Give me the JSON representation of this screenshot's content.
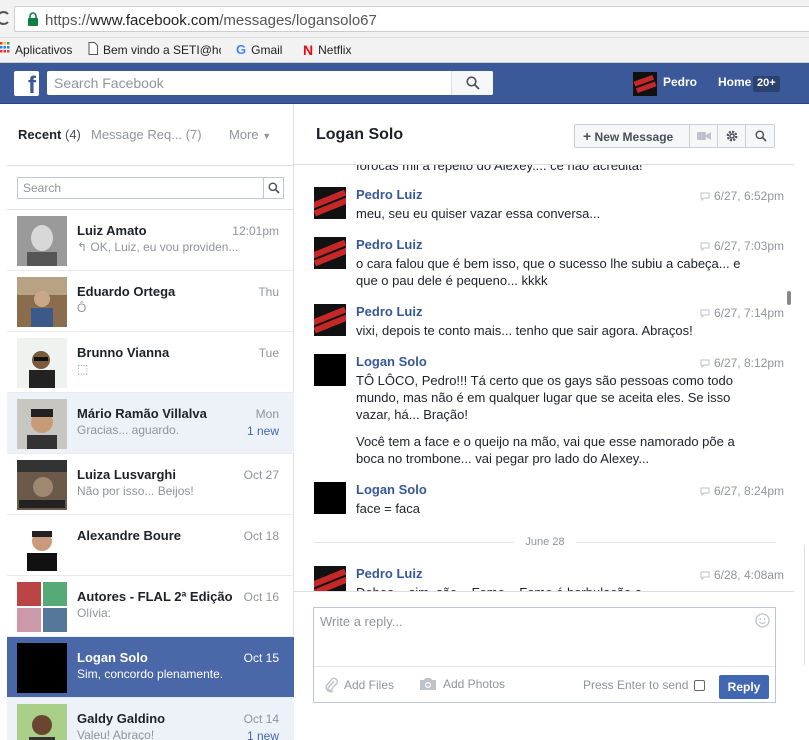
{
  "browser": {
    "url_prefix": "https://",
    "url_host": "www.facebook.com",
    "url_path": "/messages/logansolo67",
    "bookmarks": [
      {
        "label": "Aplicativos",
        "icon": "apps-grid-icon"
      },
      {
        "label": "Bem vindo a SETI@hc",
        "icon": "page-icon"
      },
      {
        "label": "Gmail",
        "icon": "google-icon"
      },
      {
        "label": "Netflix",
        "icon": "netflix-icon"
      }
    ]
  },
  "topbar": {
    "search_placeholder": "Search Facebook",
    "user_name": "Pedro",
    "home_label": "Home",
    "home_badge": "20+"
  },
  "left": {
    "tab_recent": "Recent",
    "tab_recent_count": "(4)",
    "tab_requests": "Message Req...",
    "tab_requests_count": "(7)",
    "tab_more": "More",
    "search_placeholder": "Search",
    "threads": [
      {
        "name": "Luiz Amato",
        "preview": "↰ OK, Luiz, eu vou providen...",
        "time": "12:01pm",
        "badge": "",
        "state": "normal"
      },
      {
        "name": "Eduardo Ortega",
        "preview": "Ô",
        "time": "Thu",
        "badge": "",
        "state": "normal"
      },
      {
        "name": "Brunno Vianna",
        "preview": "⬚",
        "time": "Tue",
        "badge": "",
        "state": "normal"
      },
      {
        "name": "Mário Ramão Villalva",
        "preview": "Gracias... aguardo.",
        "time": "Mon",
        "badge": "1 new",
        "state": "unread"
      },
      {
        "name": "Luiza Lusvarghi",
        "preview": "Não por isso... Beijos!",
        "time": "Oct 27",
        "badge": "",
        "state": "normal"
      },
      {
        "name": "Alexandre Boure",
        "preview": "",
        "time": "Oct 18",
        "badge": "",
        "state": "normal"
      },
      {
        "name": "Autores - FLAL 2ª Edição",
        "preview": "Olívia:",
        "time": "Oct 16",
        "badge": "",
        "state": "normal"
      },
      {
        "name": "Logan Solo",
        "preview": "Sim, concordo plenamente.",
        "time": "Oct 15",
        "badge": "",
        "state": "active"
      },
      {
        "name": "Galdy Galdino",
        "preview": "Valeu! Abraço!",
        "time": "Oct 14",
        "badge": "1 new",
        "state": "unread"
      }
    ]
  },
  "conversation": {
    "title": "Logan Solo",
    "new_message_label": "New Message",
    "partial_top_text": "forocas mil a repeito do Alexey.... ce nao acredita!",
    "messages": [
      {
        "sender": "Pedro Luiz",
        "time": "6/27, 6:52pm",
        "avatar": "pedroom",
        "paragraphs": [
          "meu, seu eu quiser vazar essa conversa..."
        ]
      },
      {
        "sender": "Pedro Luiz",
        "time": "6/27, 7:03pm",
        "avatar": "pedroom",
        "paragraphs": [
          "o cara falou que é bem isso, que o sucesso lhe subiu a cabeça... e que o pau dele é pequeno... kkkk"
        ]
      },
      {
        "sender": "Pedro Luiz",
        "time": "6/27, 7:14pm",
        "avatar": "pedroom",
        "paragraphs": [
          "vixi, depois te conto mais... tenho que sair agora. Abraços!"
        ]
      },
      {
        "sender": "Logan Solo",
        "time": "6/27, 8:12pm",
        "avatar": "logan",
        "paragraphs": [
          "TÔ LÔCO, Pedro!!! Tá certo que os gays são pessoas como todo mundo, mas não é em qualquer lugar que se aceita eles. Se isso vazar, há... Bração!",
          "Você tem a face e o queijo na mão, vai que esse namorado põe a boca no trombone... vai pegar pro lado do Alexey..."
        ]
      },
      {
        "sender": "Logan Solo",
        "time": "6/27, 8:24pm",
        "avatar": "logan",
        "paragraphs": [
          "face = faca"
        ]
      },
      {
        "sender": "Pedro Luiz",
        "time": "6/28, 4:08am",
        "avatar": "pedroom",
        "paragraphs": [
          "Deboa... sim, são... Fome... Fome é borbulação a..."
        ]
      }
    ],
    "date_separator": "June 28"
  },
  "composer": {
    "placeholder": "Write a reply...",
    "add_files": "Add Files",
    "add_photos": "Add Photos",
    "press_enter": "Press Enter to send",
    "reply_label": "Reply"
  }
}
